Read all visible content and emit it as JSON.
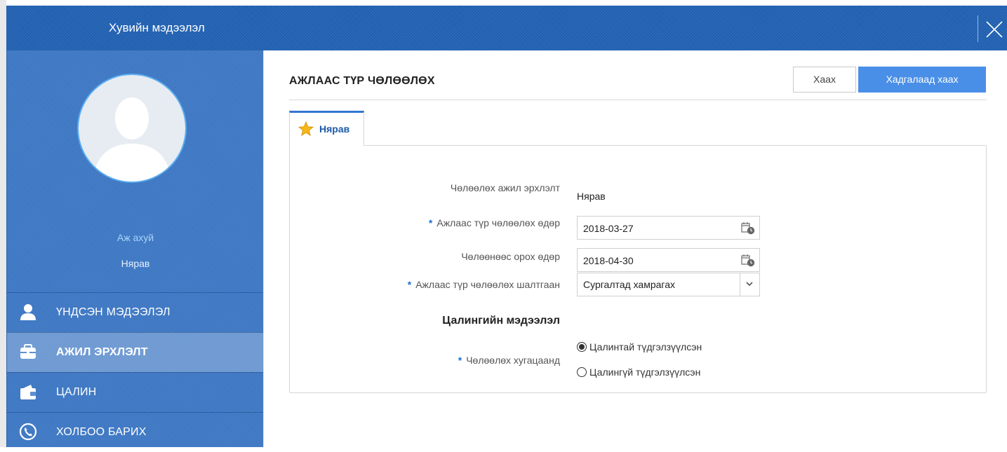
{
  "window": {
    "title": "Хувийн мэдээлэл"
  },
  "profile": {
    "role": "Аж ахуй",
    "name": "Нярав"
  },
  "sidebar": {
    "items": [
      {
        "label": "ҮНДСЭН МЭДЭЭЛЭЛ",
        "icon": "person-icon",
        "active": false
      },
      {
        "label": "АЖИЛ ЭРХЛЭЛТ",
        "icon": "briefcase-icon",
        "active": true
      },
      {
        "label": "ЦАЛИН",
        "icon": "wallet-icon",
        "active": false
      },
      {
        "label": "ХОЛБОО БАРИХ",
        "icon": "phone-icon",
        "active": false
      }
    ]
  },
  "header": {
    "title": "АЖЛААС ТҮР ЧӨЛӨӨЛӨХ",
    "close_label": "Хаах",
    "save_label": "Хадгалаад хаах"
  },
  "tab": {
    "label": "Нярав"
  },
  "form": {
    "position": {
      "label": "Чөлөөлөх ажил эрхлэлт",
      "value": "Нярав"
    },
    "release_date": {
      "label": "Ажлаас түр чөлөөлөх өдөр",
      "required": true,
      "value": "2018-03-27"
    },
    "return_date": {
      "label": "Чөлөөнөөс орох өдөр",
      "value": "2018-04-30"
    },
    "reason": {
      "label": "Ажлаас түр чөлөөлөх шалтгаан",
      "required": true,
      "value": "Сургалтад хамрагах"
    },
    "salary_section_title": "Цалингийн мэдээлэл",
    "period": {
      "label": "Чөлөөлөх хугацаанд",
      "required": true,
      "options": [
        "Цалинтай түдгэлзүүлсэн",
        "Цалингүй түдгэлзүүлсэн"
      ],
      "selected_index": 0
    }
  },
  "colors": {
    "header_blue": "#1f5fb0",
    "sidebar_blue": "#3d77c3",
    "accent": "#4a8fe7",
    "required_star": "#1f6fd1"
  }
}
